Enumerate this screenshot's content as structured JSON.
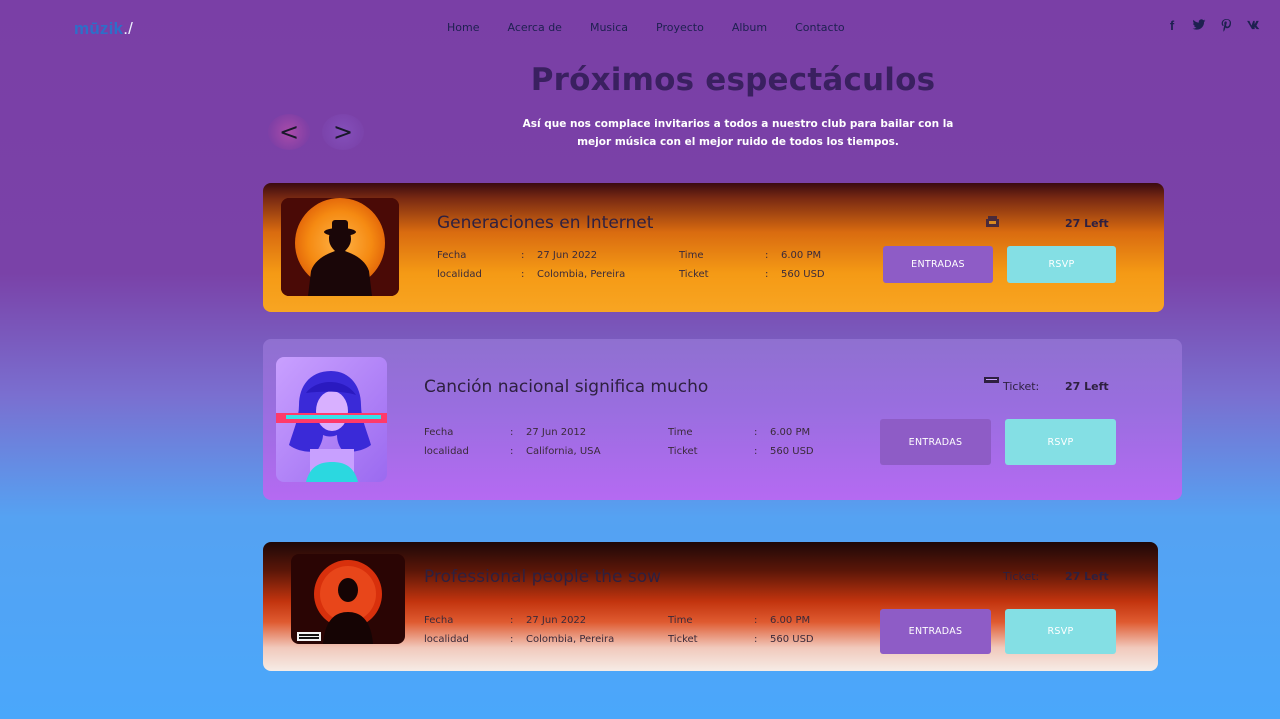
{
  "brand": {
    "logo": "mūzik",
    "logo_suffix": "./"
  },
  "nav": [
    "Home",
    "Acerca de",
    "Musica",
    "Proyecto",
    "Album",
    "Contacto"
  ],
  "social": [
    {
      "icon": "facebook-icon",
      "glyph": "f"
    },
    {
      "icon": "twitter-icon",
      "glyph": "t"
    },
    {
      "icon": "pinterest-icon",
      "glyph": "p"
    },
    {
      "icon": "vk-icon",
      "glyph": "vk"
    }
  ],
  "section": {
    "title": "Próximos espectáculos",
    "subtitle": "Así que nos complace invitarios a todos a nuestro club para bailar con la mejor música con el mejor ruido de todos los tiempos.",
    "prev": "<",
    "next": ">"
  },
  "events": [
    {
      "title": "Generaciones en Internet",
      "fecha_label": "Fecha",
      "fecha": "27 Jun 2022",
      "localidad_label": "localidad",
      "localidad": "Colombia, Pereira",
      "time_label": "Time",
      "time": "6.00 PM",
      "ticket_label": "Ticket",
      "ticket": "560 USD",
      "ticket_tag": "",
      "left": "27 Left",
      "entradas": "ENTRADAS",
      "rsvp": "RSVP"
    },
    {
      "title": "Canción nacional significa mucho",
      "fecha_label": "Fecha",
      "fecha": "27 Jun 2012",
      "localidad_label": "localidad",
      "localidad": "California, USA",
      "time_label": "Time",
      "time": "6.00 PM",
      "ticket_label": "Ticket",
      "ticket": "560 USD",
      "ticket_tag": "Ticket:",
      "left": "27 Left",
      "entradas": "ENTRADAS",
      "rsvp": "RSVP"
    },
    {
      "title": "Professional people the sow",
      "fecha_label": "Fecha",
      "fecha": "27 Jun 2022",
      "localidad_label": "localidad",
      "localidad": "Colombia, Pereira",
      "time_label": "Time",
      "time": "6.00 PM",
      "ticket_label": "Ticket",
      "ticket": "560 USD",
      "ticket_tag": "Ticket:",
      "left": "27 Left",
      "entradas": "ENTRADAS",
      "rsvp": "RSVP",
      "album_mark": "PARENTAL ADVISORY"
    }
  ],
  "colors": {
    "accent_purple": "#8e5cc6",
    "rsvp_cyan": "#84dfe4",
    "heading": "#3a2060"
  }
}
